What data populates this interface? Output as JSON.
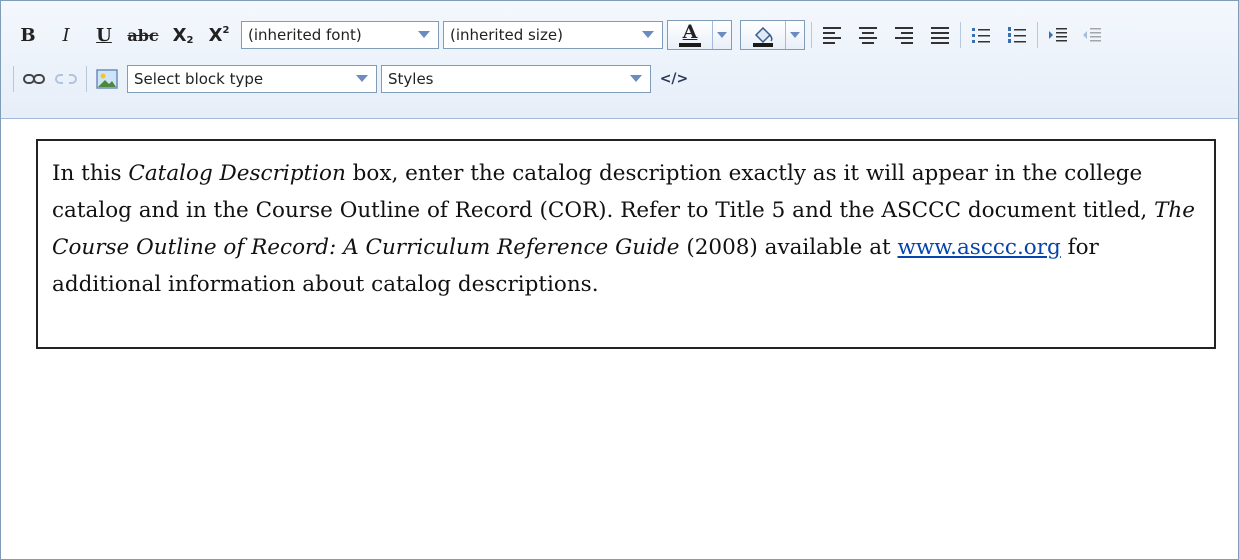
{
  "toolbar": {
    "bold_label": "B",
    "italic_label": "I",
    "underline_label": "U",
    "strike_label": "abc",
    "subscript_label": "X",
    "subscript_suffix": "2",
    "superscript_label": "X",
    "superscript_suffix": "2",
    "font_select": "(inherited font)",
    "size_select": "(inherited size)",
    "font_color_label": "A",
    "block_type_select": "Select block type",
    "styles_select": "Styles",
    "source_label": "</>",
    "icons": [
      "bold-icon",
      "italic-icon",
      "underline-icon",
      "strikethrough-icon",
      "subscript-icon",
      "superscript-icon",
      "font-color-icon",
      "highlight-icon",
      "align-left-icon",
      "align-center-icon",
      "align-right-icon",
      "justify-icon",
      "bullet-list-icon",
      "numbered-list-icon",
      "indent-icon",
      "outdent-icon",
      "link-icon",
      "unlink-icon",
      "image-icon",
      "source-code-icon"
    ],
    "accent_color": "#6c8cc0",
    "font_color_bar": "#1a1a1a",
    "highlight_color_bar": "#1a1a1a"
  },
  "content": {
    "part1": "In this ",
    "italic1": "Catalog Description",
    "part2": " box, enter the catalog description exactly as it will appear in the college catalog and in the Course Outline of Record (COR).  Refer to Title 5 and the ASCCC document titled, ",
    "italic2": "The Course Outline of Record: A Curriculum Reference Guide",
    "part3": " (2008) available at ",
    "link_text": "www.asccc.org",
    "part4": " for additional information about catalog descriptions."
  }
}
